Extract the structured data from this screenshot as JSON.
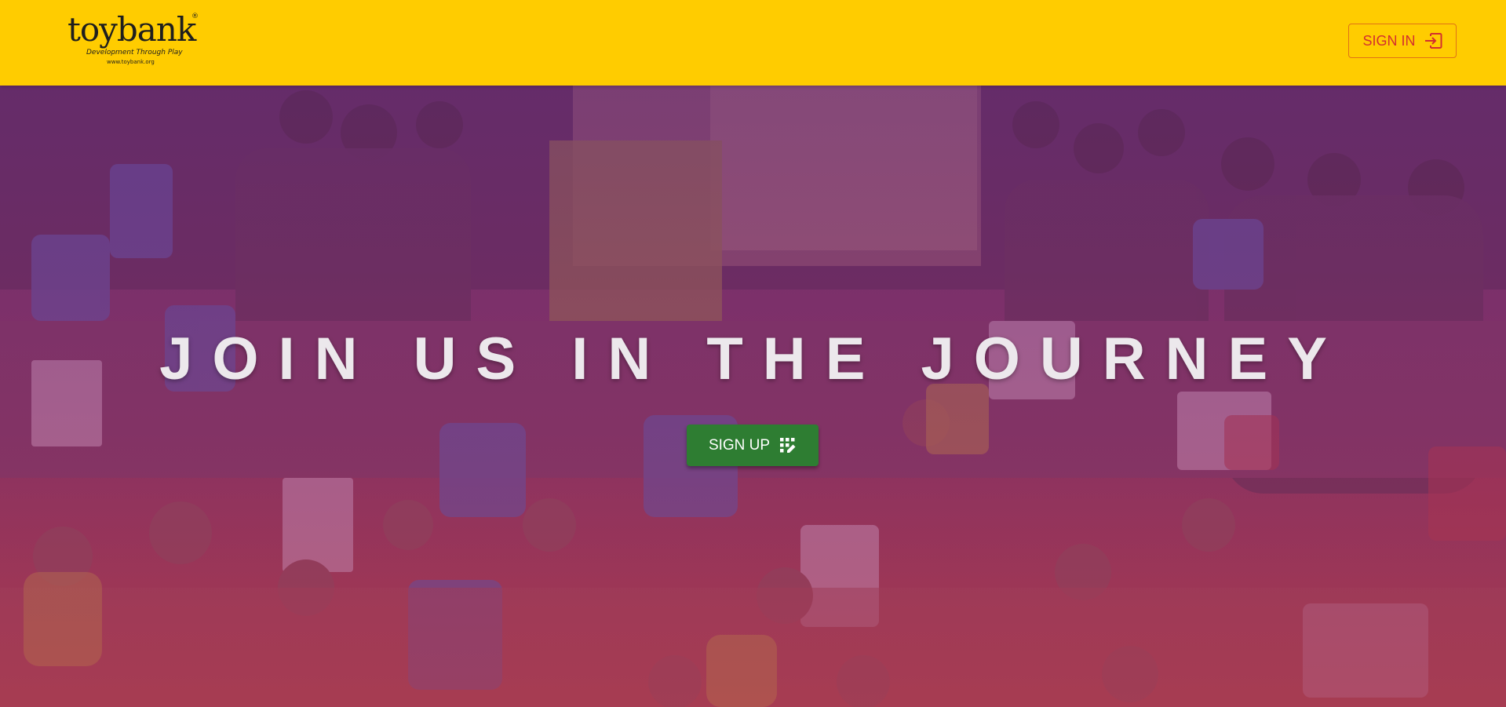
{
  "header": {
    "logo": {
      "wordmark": "toybank",
      "registered_mark": "®",
      "tagline": "Development Through Play",
      "url": "www.toybank.org"
    },
    "signin_label": "SIGN IN",
    "signin_icon": "login-icon",
    "background_color": "#ffcc00",
    "accent_color": "#d32f2f"
  },
  "hero": {
    "title": "JOIN US IN THE JOURNEY",
    "background": "photo-of-children-holding-toys",
    "signup_label": "SIGN UP",
    "signup_icon": "app-registration-icon",
    "signup_color": "#2e7d32"
  }
}
